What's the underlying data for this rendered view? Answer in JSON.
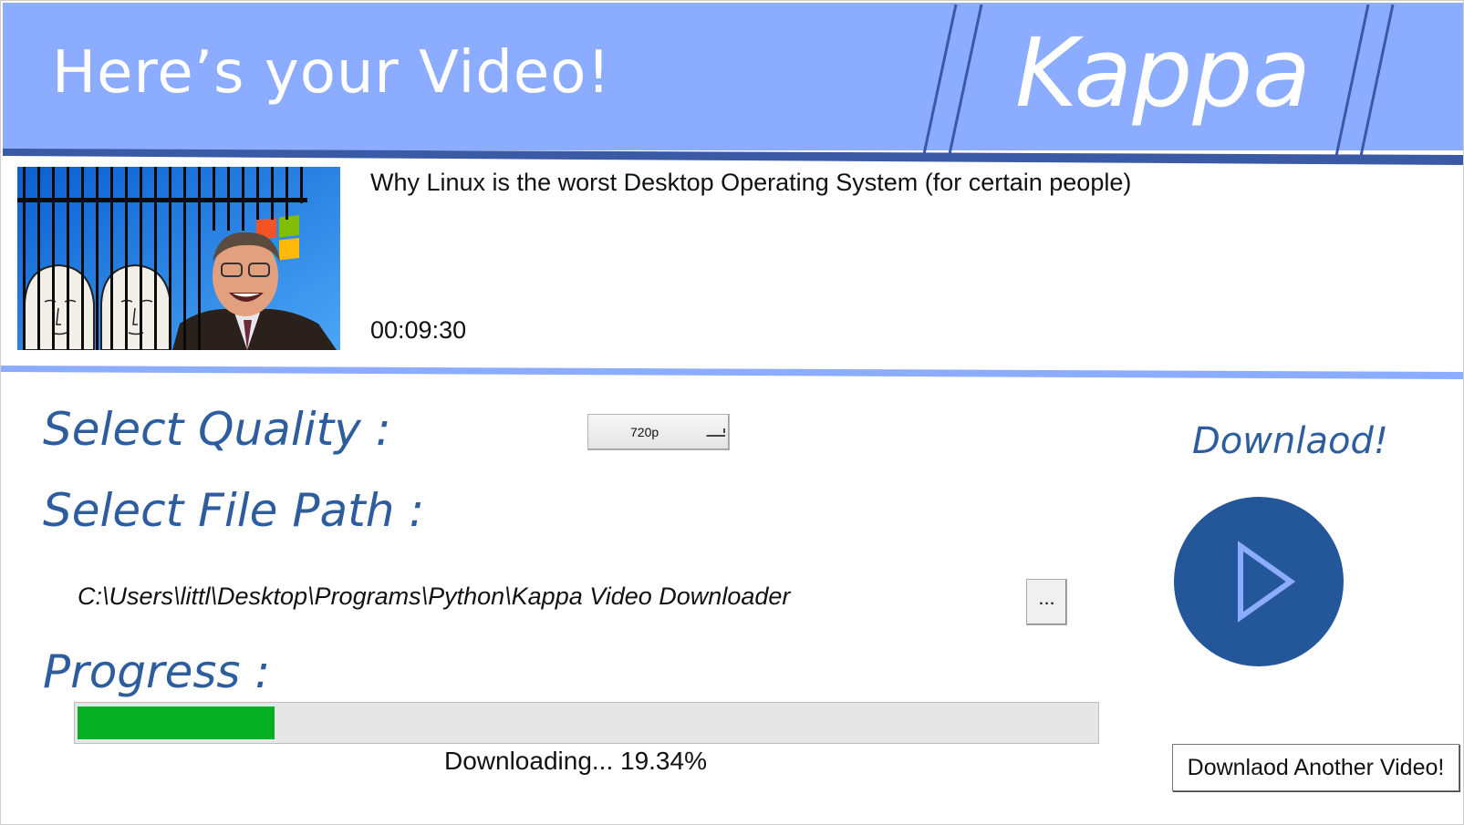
{
  "header": {
    "title": "Here’s your Video!",
    "brand": "Kappa",
    "colors": {
      "banner": "#8cacff",
      "stripe": "#3a5aa6"
    }
  },
  "video": {
    "title": "Why Linux is the worst Desktop Operating System (for certain people)",
    "duration": "00:09:30"
  },
  "quality": {
    "label": "Select Quality :",
    "selected": "720p",
    "icon": "chevron-down-icon"
  },
  "file_path": {
    "label": "Select File Path :",
    "value": "C:\\Users\\littl\\Desktop\\Programs\\Python\\Kappa Video Downloader",
    "browse_label": "..."
  },
  "progress": {
    "label": "Progress :",
    "percent": 19.34,
    "status": "Downloading... 19.34%",
    "fill_color": "#06b025"
  },
  "download": {
    "label": "Downlaod!",
    "icon": "play-icon",
    "button_color": "#24569a"
  },
  "another_button": {
    "label": "Downlaod Another Video!"
  },
  "accent_color": "#2d5d9c"
}
